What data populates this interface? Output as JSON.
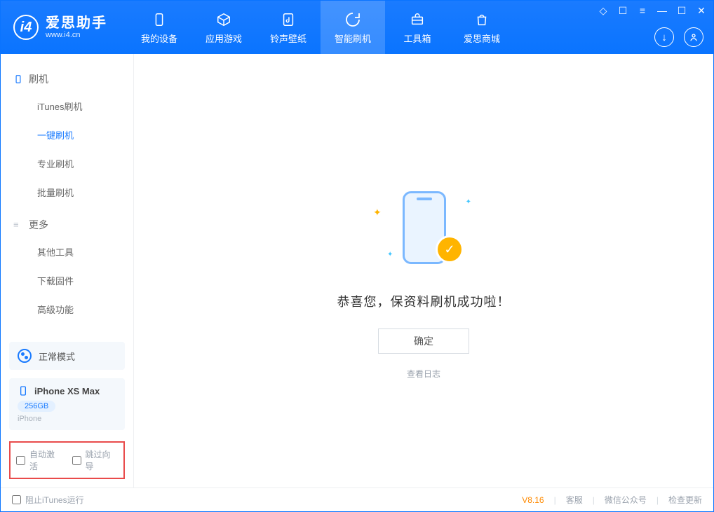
{
  "app": {
    "title": "爱思助手",
    "subtitle": "www.i4.cn"
  },
  "tabs": {
    "device": "我的设备",
    "apps": "应用游戏",
    "rings": "铃声壁纸",
    "flash": "智能刷机",
    "tools": "工具箱",
    "store": "爱思商城"
  },
  "sidebar": {
    "group1_title": "刷机",
    "items1": {
      "itunes": "iTunes刷机",
      "oneclick": "一键刷机",
      "pro": "专业刷机",
      "batch": "批量刷机"
    },
    "group2_title": "更多",
    "items2": {
      "other": "其他工具",
      "firmware": "下载固件",
      "advanced": "高级功能"
    }
  },
  "mode": {
    "label": "正常模式"
  },
  "device": {
    "name": "iPhone XS Max",
    "storage": "256GB",
    "type": "iPhone"
  },
  "checkboxes": {
    "auto_activate": "自动激活",
    "skip_guide": "跳过向导"
  },
  "main": {
    "success_msg": "恭喜您，保资料刷机成功啦！",
    "ok_button": "确定",
    "log_link": "查看日志"
  },
  "footer": {
    "block_itunes": "阻止iTunes运行",
    "version": "V8.16",
    "service": "客服",
    "wechat": "微信公众号",
    "update": "检查更新"
  }
}
